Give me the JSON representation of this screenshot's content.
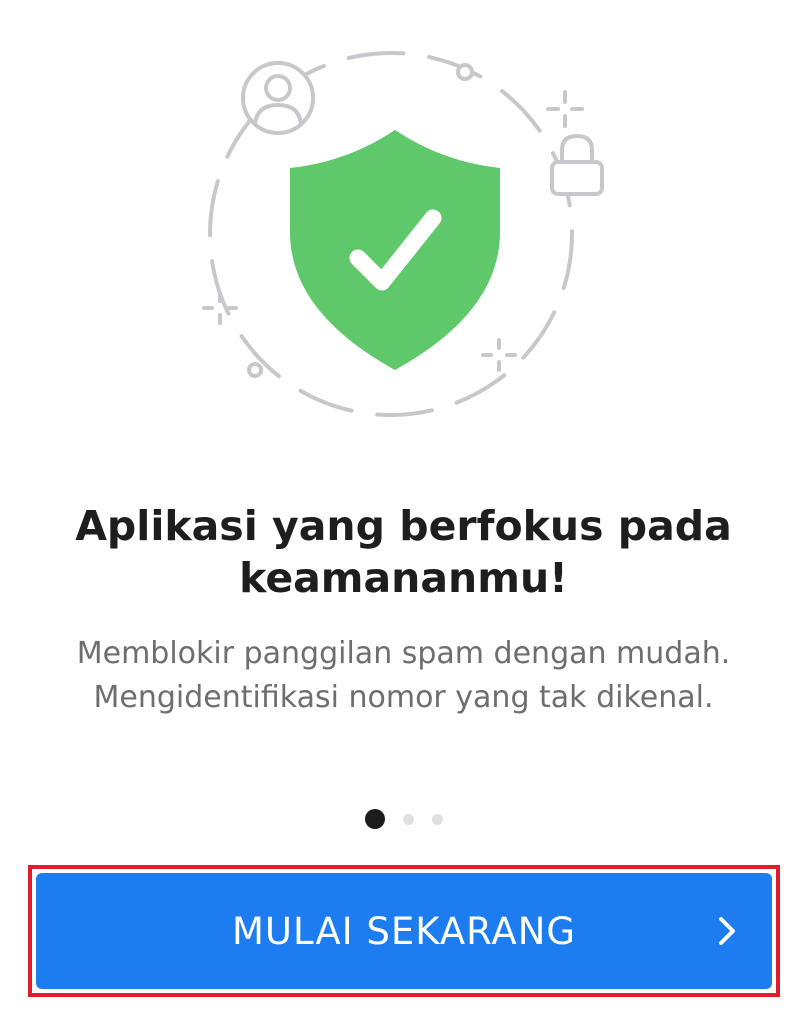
{
  "onboarding": {
    "title": "Aplikasi yang berfokus pada keamananmu!",
    "description": "Memblokir panggilan spam dengan mudah. Mengidentifikasi nomor yang tak dikenal.",
    "page_indicator": {
      "total_pages": 3,
      "current_page": 1
    },
    "cta_label": "MULAI SEKARANG"
  },
  "icons": {
    "illustration": "shield-check-icon",
    "user": "user-circle-icon",
    "lock": "lock-icon",
    "sparkle": "sparkle-icon",
    "chevron": "chevron-right-icon"
  },
  "colors": {
    "shield": "#5fc86a",
    "button": "#1c7cf0",
    "highlight_border": "#e01e2b",
    "illustration_line": "#c6c8cc"
  }
}
